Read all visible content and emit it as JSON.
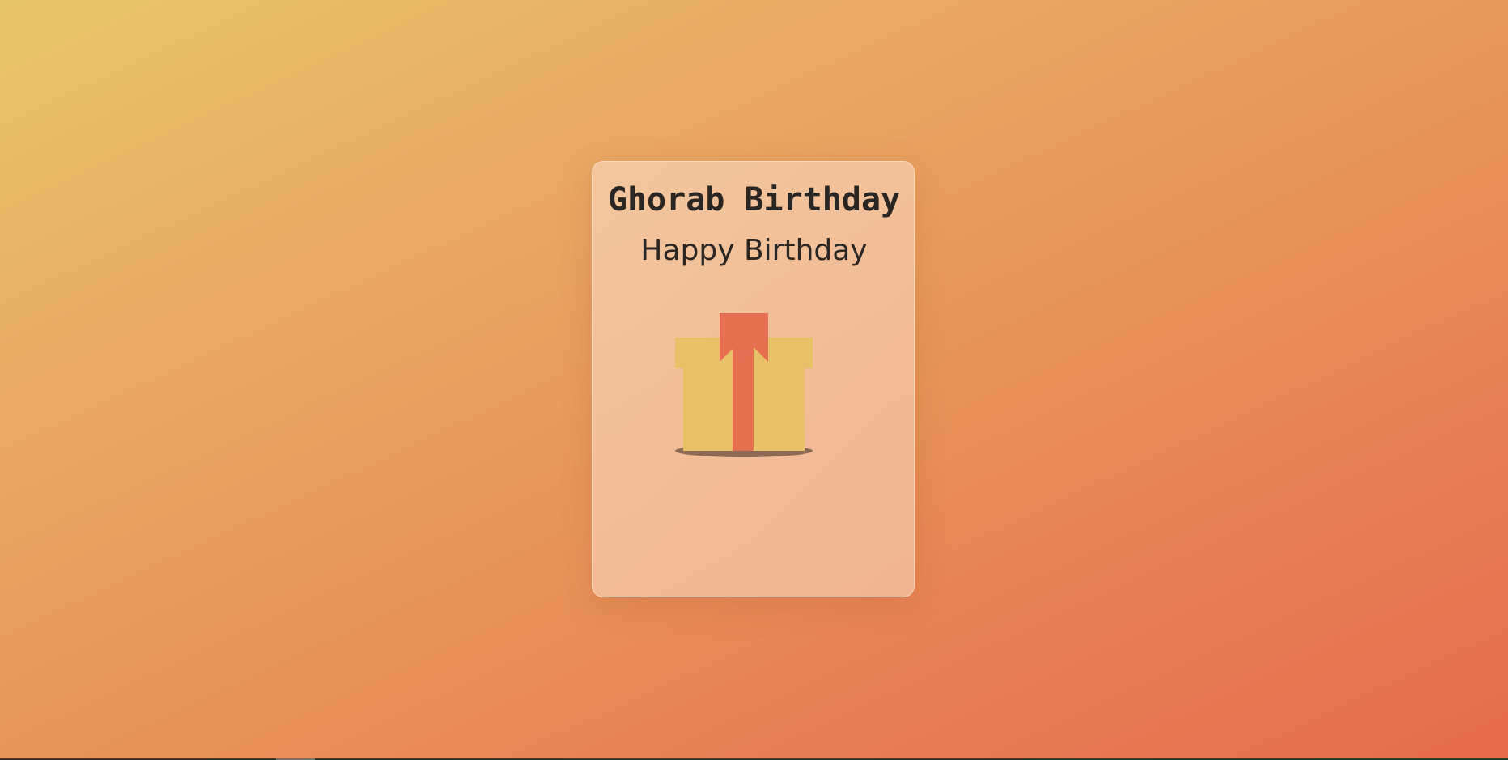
{
  "card": {
    "title": "Ghorab Birthday",
    "subtitle": "Happy Birthday"
  },
  "gift": {
    "icon": "gift-box-icon",
    "box_color": "#e8c067",
    "ribbon_color": "#e66f52",
    "shadow_color": "#8c6a55"
  },
  "colors": {
    "background_start": "#e8c66a",
    "background_end": "#e66c4e",
    "text": "#2a2624"
  }
}
